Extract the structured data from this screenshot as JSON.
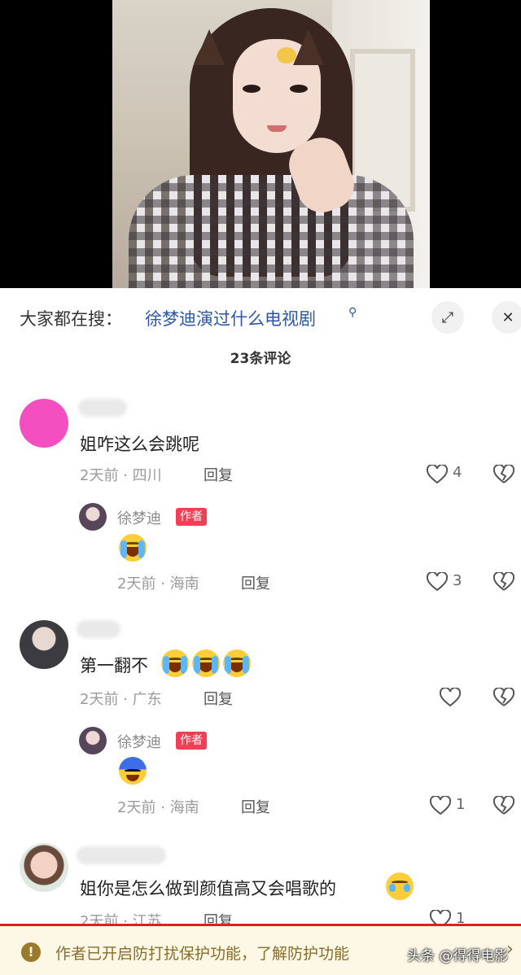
{
  "search": {
    "label": "大家都在搜：",
    "query": "徐梦迪演过什么电视剧",
    "search_icon": "magnifier-icon",
    "expand_icon": "expand-icon",
    "close_icon": "close-icon",
    "close_glyph": "✕",
    "expand_glyph": "⤢"
  },
  "comments_header": {
    "count_text": "23条评论"
  },
  "comments": [
    {
      "text": "姐咋这么会跳呢",
      "time": "2天前",
      "location": "四川",
      "reply": "回复",
      "likes": "4",
      "author_reply": {
        "name": "徐梦迪",
        "badge": "作者",
        "emoji": "loudly-crying-face",
        "time": "2天前",
        "location": "海南",
        "reply": "回复",
        "likes": "3"
      }
    },
    {
      "text": "第一翻不",
      "emojis": [
        "loudly-crying-face",
        "loudly-crying-face",
        "loudly-crying-face"
      ],
      "time": "2天前",
      "location": "广东",
      "reply": "回复",
      "likes": "",
      "author_reply": {
        "name": "徐梦迪",
        "badge": "作者",
        "emoji": "scared-blue-face",
        "time": "2天前",
        "location": "海南",
        "reply": "回复",
        "likes": "1"
      }
    },
    {
      "text": "姐你是怎么做到颜值高又会唱歌的",
      "emojis": [
        "pleading-face"
      ],
      "time": "2天前",
      "location": "江苏",
      "reply": "回复",
      "likes": "1"
    }
  ],
  "separator": "·",
  "notice": {
    "icon_glyph": "!",
    "text": "作者已开启防打扰保护功能，了解防护功能",
    "watermark": "头条 @得得电影",
    "arrow": "›"
  },
  "colors": {
    "link": "#2b57a6",
    "badge": "#f33f56",
    "notice_bg": "#fdf7e6",
    "highlight_border": "#e02020"
  }
}
